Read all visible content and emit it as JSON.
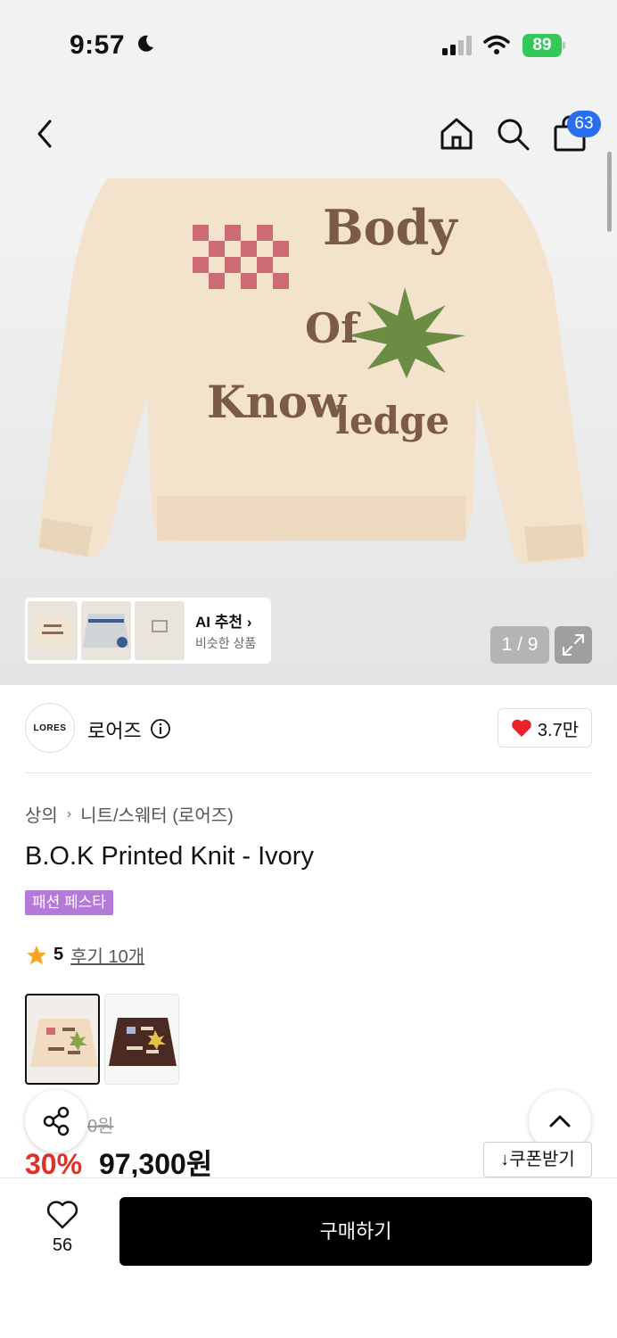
{
  "status_bar": {
    "time": "9:57",
    "battery": "89"
  },
  "nav": {
    "cart_count": "63",
    "icons": [
      "back-icon",
      "home-icon",
      "search-icon",
      "bag-icon"
    ]
  },
  "hero": {
    "sweater_text": [
      "Body",
      "Of",
      "Know",
      "ledge"
    ],
    "ai_card": {
      "title": "AI 추천",
      "subtitle": "비슷한 상품"
    },
    "page_indicator": "1 / 9"
  },
  "brand": {
    "logo_text": "LORES",
    "name": "로어즈",
    "like_count": "3.7만"
  },
  "breadcrumb": {
    "category": "상의",
    "subcategory": "니트/스웨터 (로어즈)"
  },
  "product": {
    "title": "B.O.K Printed Knit - Ivory",
    "promo_badge": "패션 페스타",
    "rating": "5",
    "reviews": "후기 10개",
    "original_price": "0원",
    "discount": "30%",
    "price": "97,300원",
    "coupon_label": "쿠폰받기"
  },
  "bottom": {
    "wish_count": "56",
    "buy_label": "구매하기"
  },
  "colors": {
    "accent_red": "#e0302a",
    "promo_purple": "#b57ad9",
    "badge_blue": "#2a6ef0",
    "battery_green": "#34c759"
  }
}
